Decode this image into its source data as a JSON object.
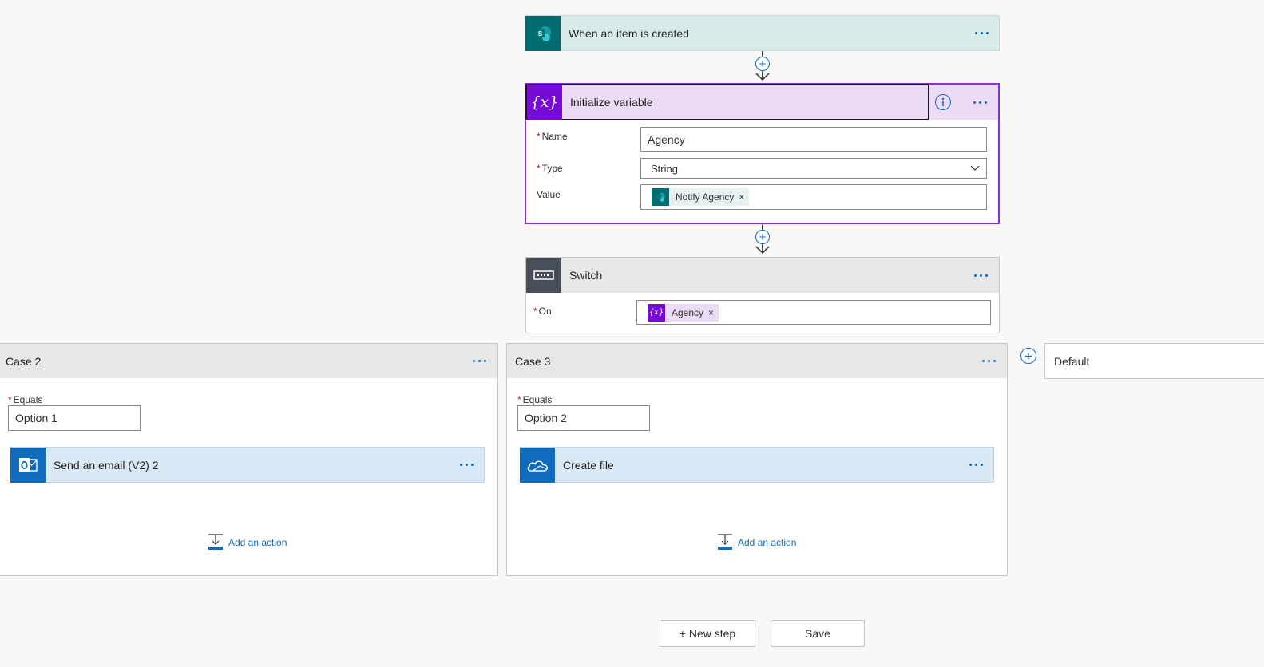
{
  "trigger": {
    "title": "When an item is created",
    "icon": "sharepoint-icon",
    "color": "#036c70"
  },
  "init_variable": {
    "title": "Initialize variable",
    "icon": "variable-icon",
    "color": "#770bd6",
    "name_label": "Name",
    "name_value": "Agency",
    "type_label": "Type",
    "type_value": "String",
    "value_label": "Value",
    "value_token": "Notify Agency",
    "token_close": "×"
  },
  "switch": {
    "title": "Switch",
    "icon": "switch-icon",
    "color": "#484f58",
    "on_label": "On",
    "on_token": "Agency",
    "token_close": "×"
  },
  "cases": [
    {
      "title": "Case 2",
      "equals_label": "Equals",
      "equals_value": "Option 1",
      "action_title": "Send an email (V2) 2",
      "action_icon": "outlook-icon",
      "add_action": "Add an action"
    },
    {
      "title": "Case 3",
      "equals_label": "Equals",
      "equals_value": "Option 2",
      "action_title": "Create file",
      "action_icon": "onedrive-icon",
      "add_action": "Add an action"
    }
  ],
  "default_case": {
    "title": "Default"
  },
  "footer": {
    "new_step": "+ New step",
    "save": "Save"
  },
  "symbols": {
    "required": "*",
    "plus": "+",
    "var_glyph": "{x}"
  }
}
